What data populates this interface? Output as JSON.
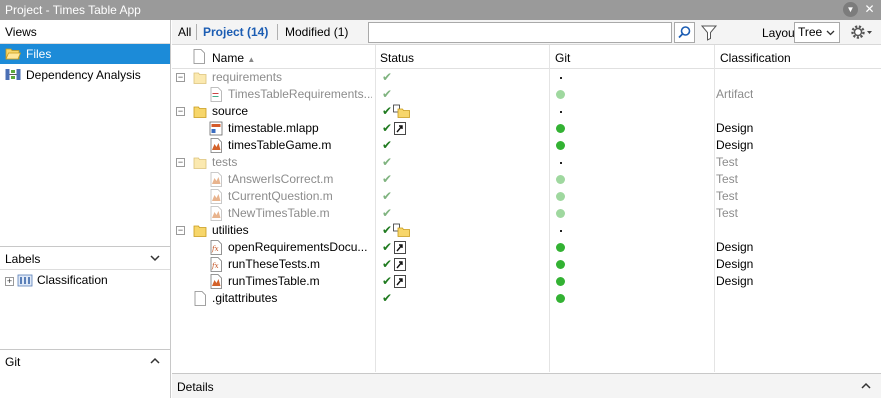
{
  "window": {
    "title": "Project - Times Table App"
  },
  "left": {
    "views_header": "Views",
    "views": [
      {
        "label": "Files",
        "icon": "folder-open-icon",
        "selected": true
      },
      {
        "label": "Dependency Analysis",
        "icon": "dependency-graph-icon",
        "selected": false
      }
    ],
    "labels_header": "Labels",
    "labels": [
      {
        "label": "Classification",
        "icon": "label-category-icon"
      }
    ],
    "git_header": "Git"
  },
  "toolbar": {
    "tabs": [
      {
        "label": "All",
        "active": false
      },
      {
        "label": "Project (14)",
        "active": true
      },
      {
        "label": "Modified (1)",
        "active": false
      }
    ],
    "search": {
      "value": "",
      "placeholder": ""
    },
    "layout_label": "Layout:",
    "layout_value": "Tree"
  },
  "table": {
    "columns": [
      "Name",
      "Status",
      "Git",
      "Classification"
    ],
    "sort_indicator": "▲",
    "rows": [
      {
        "name": "requirements",
        "type": "folder",
        "depth": 0,
        "expander": "−",
        "muted": true,
        "status": "check",
        "git": "small",
        "classification": ""
      },
      {
        "name": "TimesTableRequirements....",
        "type": "req",
        "depth": 1,
        "expander": "",
        "muted": true,
        "status": "check",
        "git": "light",
        "classification": "Artifact"
      },
      {
        "name": "source",
        "type": "folder",
        "depth": 0,
        "expander": "−",
        "muted": false,
        "status": "check-folder",
        "git": "small",
        "classification": ""
      },
      {
        "name": "timestable.mlapp",
        "type": "mlapp",
        "depth": 1,
        "expander": "",
        "muted": false,
        "status": "check-shortcut",
        "git": "green",
        "classification": "Design"
      },
      {
        "name": "timesTableGame.m",
        "type": "mfile",
        "depth": 1,
        "expander": "",
        "muted": false,
        "status": "check",
        "git": "green",
        "classification": "Design"
      },
      {
        "name": "tests",
        "type": "folder",
        "depth": 0,
        "expander": "−",
        "muted": true,
        "status": "check",
        "git": "small",
        "classification": "Test"
      },
      {
        "name": "tAnswerIsCorrect.m",
        "type": "mfile",
        "depth": 1,
        "expander": "",
        "muted": true,
        "status": "check",
        "git": "light",
        "classification": "Test"
      },
      {
        "name": "tCurrentQuestion.m",
        "type": "mfile",
        "depth": 1,
        "expander": "",
        "muted": true,
        "status": "check",
        "git": "light",
        "classification": "Test"
      },
      {
        "name": "tNewTimesTable.m",
        "type": "mfile",
        "depth": 1,
        "expander": "",
        "muted": true,
        "status": "check",
        "git": "light",
        "classification": "Test"
      },
      {
        "name": "utilities",
        "type": "folder",
        "depth": 0,
        "expander": "−",
        "muted": false,
        "status": "check-folder",
        "git": "small",
        "classification": ""
      },
      {
        "name": "openRequirementsDocu...",
        "type": "fxfile",
        "depth": 1,
        "expander": "",
        "muted": false,
        "status": "check-shortcut",
        "git": "green",
        "classification": "Design"
      },
      {
        "name": "runTheseTests.m",
        "type": "fxfile",
        "depth": 1,
        "expander": "",
        "muted": false,
        "status": "check-shortcut",
        "git": "green",
        "classification": "Design"
      },
      {
        "name": "runTimesTable.m",
        "type": "mfile",
        "depth": 1,
        "expander": "",
        "muted": false,
        "status": "check-shortcut",
        "git": "green",
        "classification": "Design"
      },
      {
        "name": ".gitattributes",
        "type": "doc",
        "depth": 0,
        "expander": "",
        "muted": false,
        "status": "check",
        "git": "green",
        "classification": ""
      }
    ]
  },
  "details": {
    "label": "Details"
  },
  "colors": {
    "selection": "#1c8bd8",
    "git_green": "#33b233",
    "git_light": "#9fd89f",
    "status_check": "#1f7a1f",
    "folder": "#f7d66a"
  }
}
